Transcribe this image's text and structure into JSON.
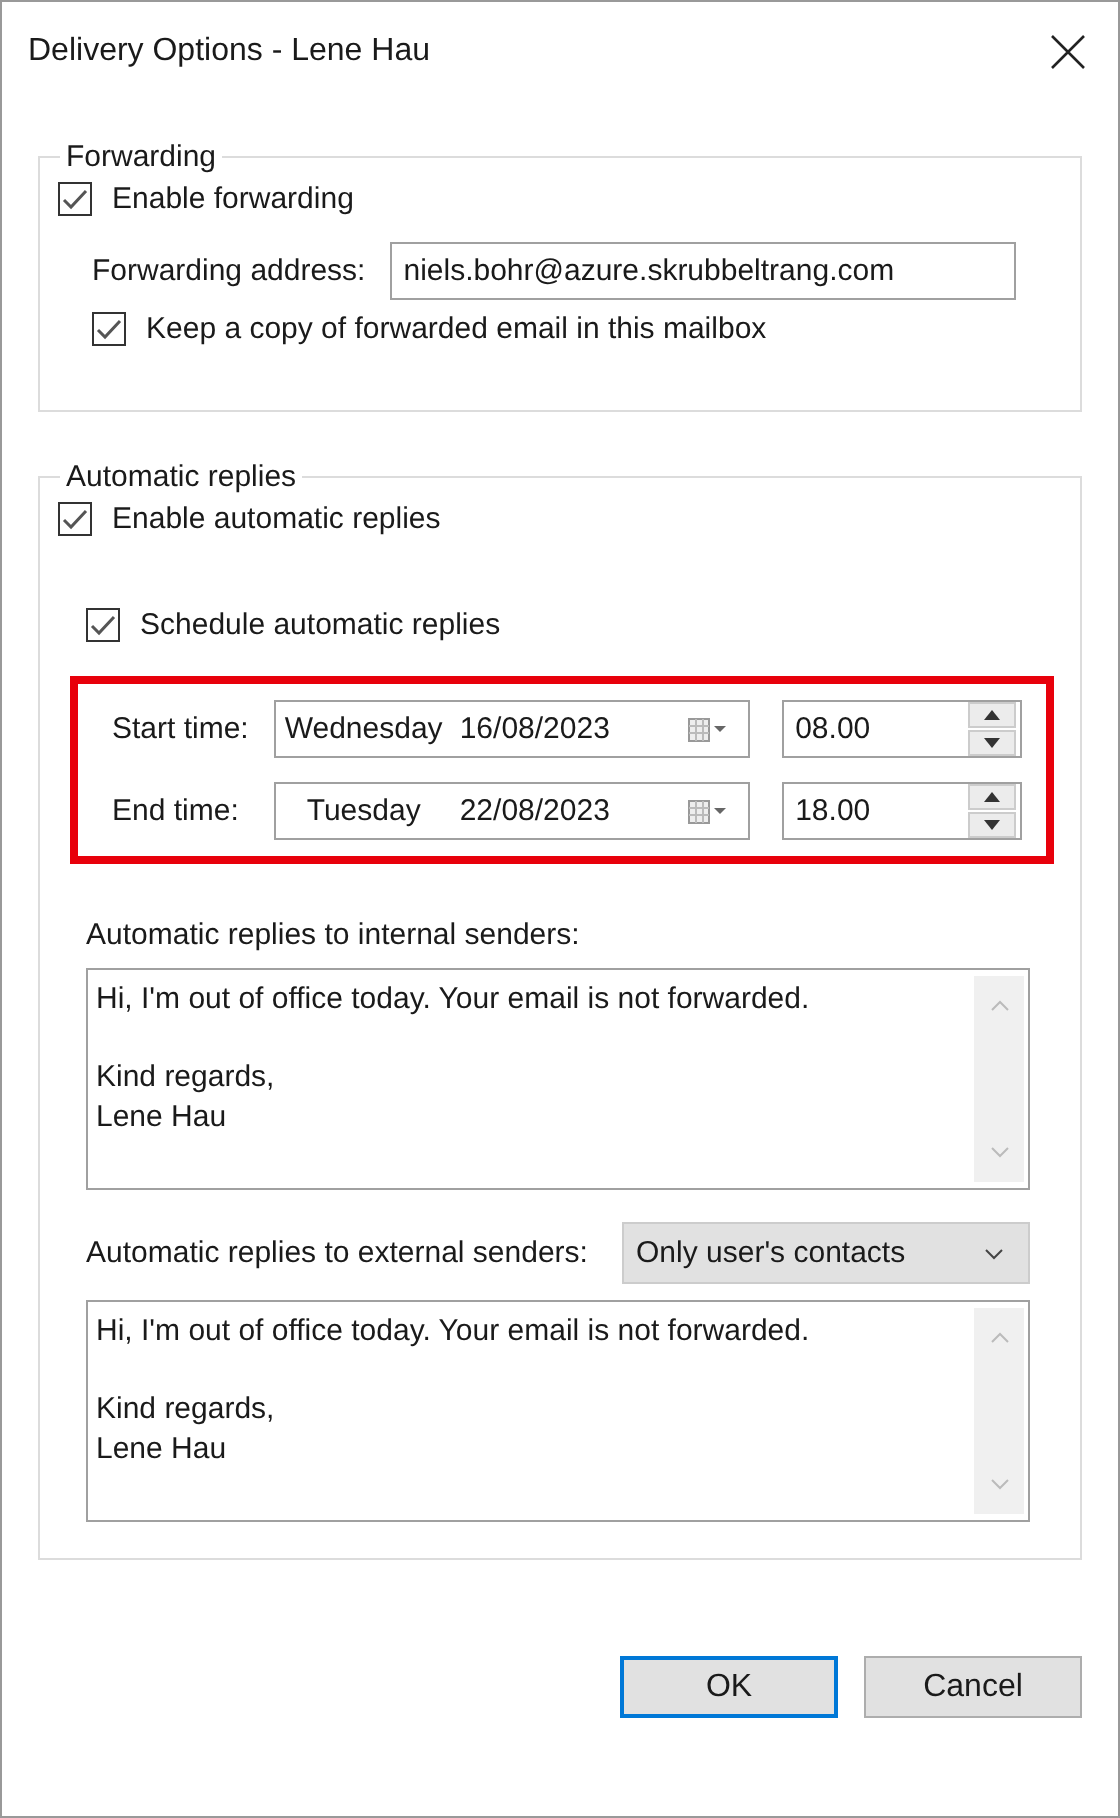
{
  "window": {
    "title": "Delivery Options - Lene Hau"
  },
  "forwarding": {
    "legend": "Forwarding",
    "enable": {
      "label": "Enable forwarding",
      "checked": true
    },
    "address_label": "Forwarding address:",
    "address": "niels.bohr@azure.skrubbeltrang.com",
    "keep_copy": {
      "label": "Keep a copy of forwarded email in this mailbox",
      "checked": true
    }
  },
  "automatic_replies": {
    "legend": "Automatic replies",
    "enable": {
      "label": "Enable automatic replies",
      "checked": true
    },
    "schedule": {
      "label": "Schedule automatic replies",
      "checked": true
    },
    "schedule_highlighted": true,
    "times": [
      {
        "label": "Start time:",
        "day": "Wednesday",
        "date": "16/08/2023",
        "time": "08.00"
      },
      {
        "label": "End time:",
        "day": "Tuesday",
        "date": "22/08/2023",
        "time": "18.00"
      }
    ],
    "internal": {
      "label": "Automatic replies to internal senders:",
      "message": "Hi, I'm out of office today. Your email is not forwarded.\n\nKind regards,\nLene Hau"
    },
    "external": {
      "label": "Automatic replies to external senders:",
      "audience": "Only user's contacts",
      "message": "Hi, I'm out of office today. Your email is not forwarded.\n\nKind regards,\nLene Hau"
    }
  },
  "buttons": [
    {
      "label": "OK",
      "default": true
    },
    {
      "label": "Cancel",
      "default": false
    }
  ]
}
